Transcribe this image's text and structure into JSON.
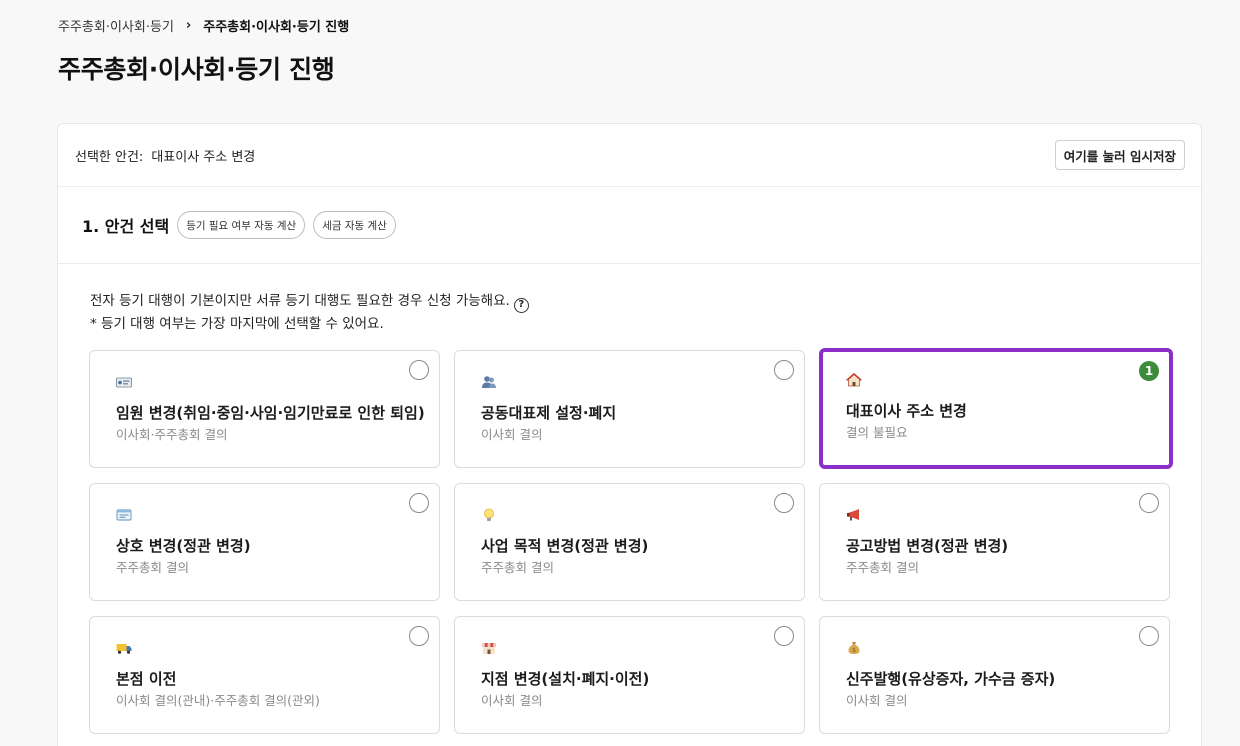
{
  "breadcrumb": {
    "parent": "주주총회·이사회·등기",
    "separator": "›",
    "current": "주주총회·이사회·등기 진행"
  },
  "page": {
    "title": "주주총회·이사회·등기 진행"
  },
  "selection": {
    "label": "선택한 안건:",
    "value": "대표이사 주소 변경",
    "save_button": "여기를 눌러 임시저장"
  },
  "section": {
    "title": "1. 안건 선택",
    "chips": [
      "등기 필요 여부 자동 계산",
      "세금 자동 계산"
    ]
  },
  "notes": {
    "line1": "전자 등기 대행이 기본이지만 서류 등기 대행도 필요한 경우 신청 가능해요.",
    "help_glyph": "?",
    "line2": "* 등기 대행 여부는 가장 마지막에 선택할 수 있어요."
  },
  "cards": [
    {
      "icon": "id-card-icon",
      "title": "임원 변경(취임·중임·사임·임기만료로 인한 퇴임)",
      "subtitle": "이사회·주주총회 결의",
      "selected": false
    },
    {
      "icon": "people-icon",
      "title": "공동대표제 설정·폐지",
      "subtitle": "이사회 결의",
      "selected": false
    },
    {
      "icon": "house-icon",
      "title": "대표이사 주소 변경",
      "subtitle": "결의 불필요",
      "selected": true,
      "badge": "1"
    },
    {
      "icon": "nameplate-icon",
      "title": "상호 변경(정관 변경)",
      "subtitle": "주주총회 결의",
      "selected": false
    },
    {
      "icon": "lightbulb-icon",
      "title": "사업 목적 변경(정관 변경)",
      "subtitle": "주주총회 결의",
      "selected": false
    },
    {
      "icon": "megaphone-icon",
      "title": "공고방법 변경(정관 변경)",
      "subtitle": "주주총회 결의",
      "selected": false
    },
    {
      "icon": "truck-icon",
      "title": "본점 이전",
      "subtitle": "이사회 결의(관내)·주주총회 결의(관외)",
      "selected": false
    },
    {
      "icon": "store-icon",
      "title": "지점 변경(설치·폐지·이전)",
      "subtitle": "이사회 결의",
      "selected": false
    },
    {
      "icon": "money-bag-icon",
      "title": "신주발행(유상증자, 가수금 증자)",
      "subtitle": "이사회 결의",
      "selected": false
    }
  ],
  "colors": {
    "selected_border": "#8c2fc9",
    "badge": "#3c8c3c"
  }
}
